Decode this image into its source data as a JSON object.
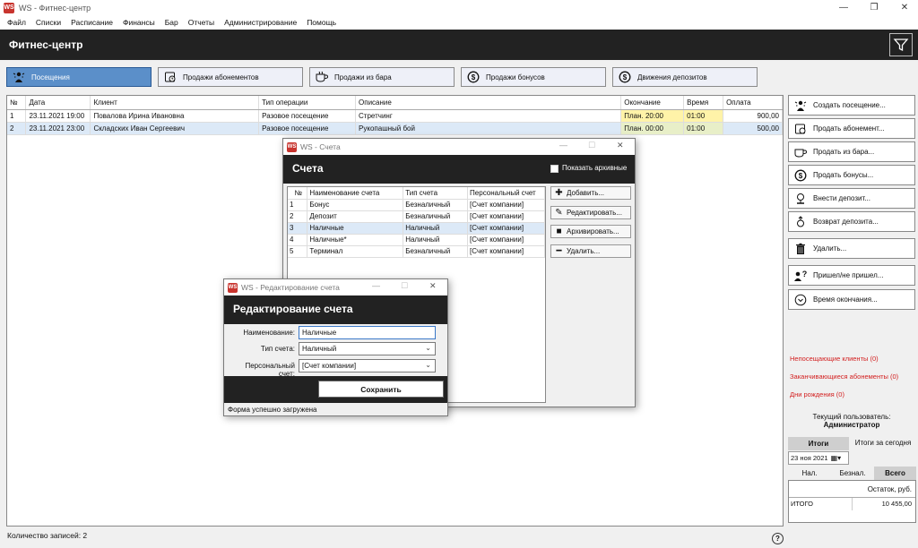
{
  "window": {
    "title": "WS - Фитнес-центр",
    "icon_text": "WS"
  },
  "menu": [
    "Файл",
    "Списки",
    "Расписание",
    "Финансы",
    "Бар",
    "Отчеты",
    "Администрирование",
    "Помощь"
  ],
  "header": {
    "title": "Фитнес-центр"
  },
  "tabs": [
    {
      "label": "Посещения",
      "icon": "person-sparkle-icon",
      "active": true
    },
    {
      "label": "Продажи абонементов",
      "icon": "card-icon"
    },
    {
      "label": "Продажи из бара",
      "icon": "cup-icon"
    },
    {
      "label": "Продажи бонусов",
      "icon": "dollar-icon"
    },
    {
      "label": "Движения депозитов",
      "icon": "dollar-icon"
    }
  ],
  "grid": {
    "columns": [
      "№",
      "Дата",
      "Клиент",
      "Тип операции",
      "Описание",
      "Окончание",
      "Время",
      "Оплата"
    ],
    "rows": [
      [
        "1",
        "23.11.2021 19:00",
        "Повалова Ирина Ивановна",
        "Разовое посещение",
        "Стретчинг",
        "План. 20:00",
        "01:00",
        "900,00"
      ],
      [
        "2",
        "23.11.2021 23:00",
        "Складских Иван Сергеевич",
        "Разовое посещение",
        "Рукопашный бой",
        "План. 00:00",
        "01:00",
        "500,00"
      ]
    ]
  },
  "actions": [
    "Создать посещение...",
    "Продать абонемент...",
    "Продать из бара...",
    "Продать бонусы...",
    "Внести депозит...",
    "Возврат депозита...",
    "Удалить...",
    "Пришел/не пришел...",
    "Время окончания..."
  ],
  "alerts": [
    "Непосещающие клиенты (0)",
    "Заканчивающиеся абонементы (0)",
    "Дни рождения (0)"
  ],
  "user": {
    "label": "Текущий пользователь:",
    "name": "Администратор"
  },
  "totals": {
    "title": "Итоги",
    "today": "Итоги за сегодня",
    "date": "23 ноя  2021",
    "tabs": [
      "Нал.",
      "Безнал.",
      "Всего"
    ],
    "balance_label": "Остаток, руб.",
    "row_label": "ИТОГО",
    "row_value": "10 455,00"
  },
  "status": {
    "records": "Количество записей: 2"
  },
  "accounts_dialog": {
    "window_title": "WS - Счета",
    "title": "Счета",
    "show_archived": "Показать архивные",
    "columns": [
      "№",
      "Наименование счета",
      "Тип счета",
      "Персональный счет"
    ],
    "rows": [
      [
        "1",
        "Бонус",
        "Безналичный",
        "[Счет компании]"
      ],
      [
        "2",
        "Депозит",
        "Безналичный",
        "[Счет компании]"
      ],
      [
        "3",
        "Наличные",
        "Наличный",
        "[Счет компании]"
      ],
      [
        "4",
        "Наличные*",
        "Наличный",
        "[Счет компании]"
      ],
      [
        "5",
        "Терминал",
        "Безналичный",
        "[Счет компании]"
      ]
    ],
    "buttons": [
      "Добавить...",
      "Редактировать...",
      "Архивировать...",
      "Удалить..."
    ]
  },
  "edit_dialog": {
    "window_title": "WS - Редактирование счета",
    "title": "Редактирование счета",
    "name_label": "Наименование:",
    "name_value": "Наличные",
    "type_label": "Тип счета:",
    "type_value": "Наличный",
    "personal_label": "Персональный счет:",
    "personal_value": "[Счет компании]",
    "save": "Сохранить",
    "status": "Форма успешно загружена"
  }
}
